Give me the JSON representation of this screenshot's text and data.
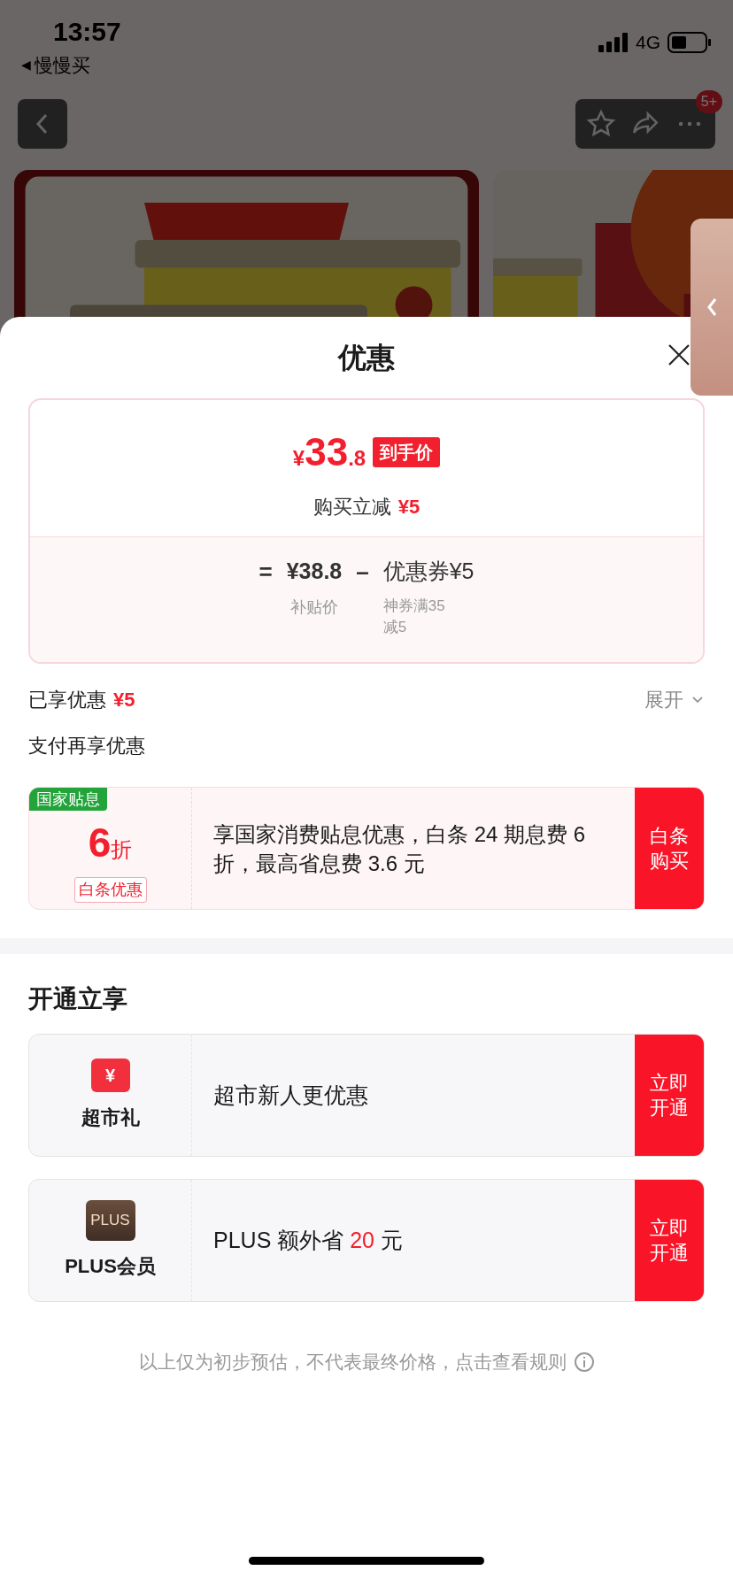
{
  "status_bar": {
    "time": "13:57",
    "back_arrow": "◀",
    "back_app": "慢慢买",
    "network": "4G"
  },
  "nav": {
    "badge": "5+"
  },
  "sheet": {
    "title": "优惠"
  },
  "price": {
    "symbol": "¥",
    "integer": "33",
    "decimal": ".8",
    "tag": "到手价",
    "instant_label": "购买立减",
    "instant_amount": "¥5"
  },
  "breakdown": {
    "equals": "=",
    "base": "¥38.8",
    "base_label": "补贴价",
    "minus": "–",
    "coupon": "优惠券¥5",
    "coupon_label": "神券满35减5"
  },
  "enjoyed": {
    "label": "已享优惠",
    "amount": "¥5",
    "toggle": "展开",
    "expanded": false
  },
  "pay_section": {
    "title": "支付再享优惠",
    "offers": [
      {
        "tag": "国家贴息",
        "big": "6",
        "unit": "折",
        "sub": "白条优惠",
        "text": "享国家消费贴息优惠，白条 24 期息费 6 折，最高省息费 3.6 元",
        "button": "白条购买"
      }
    ]
  },
  "open_section": {
    "title": "开通立享",
    "items": [
      {
        "kind": "coupon",
        "glyph": "¥",
        "label": "超市礼",
        "text_before": "超市新人更优惠",
        "button": "立即开通"
      },
      {
        "kind": "plus",
        "glyph": "PLUS",
        "label": "PLUS会员",
        "text_before": "PLUS 额外省 ",
        "highlight": "20",
        "text_after": " 元",
        "button": "立即开通"
      }
    ]
  },
  "footer": {
    "text": "以上仅为初步预估，不代表最终价格，点击查看规则"
  }
}
